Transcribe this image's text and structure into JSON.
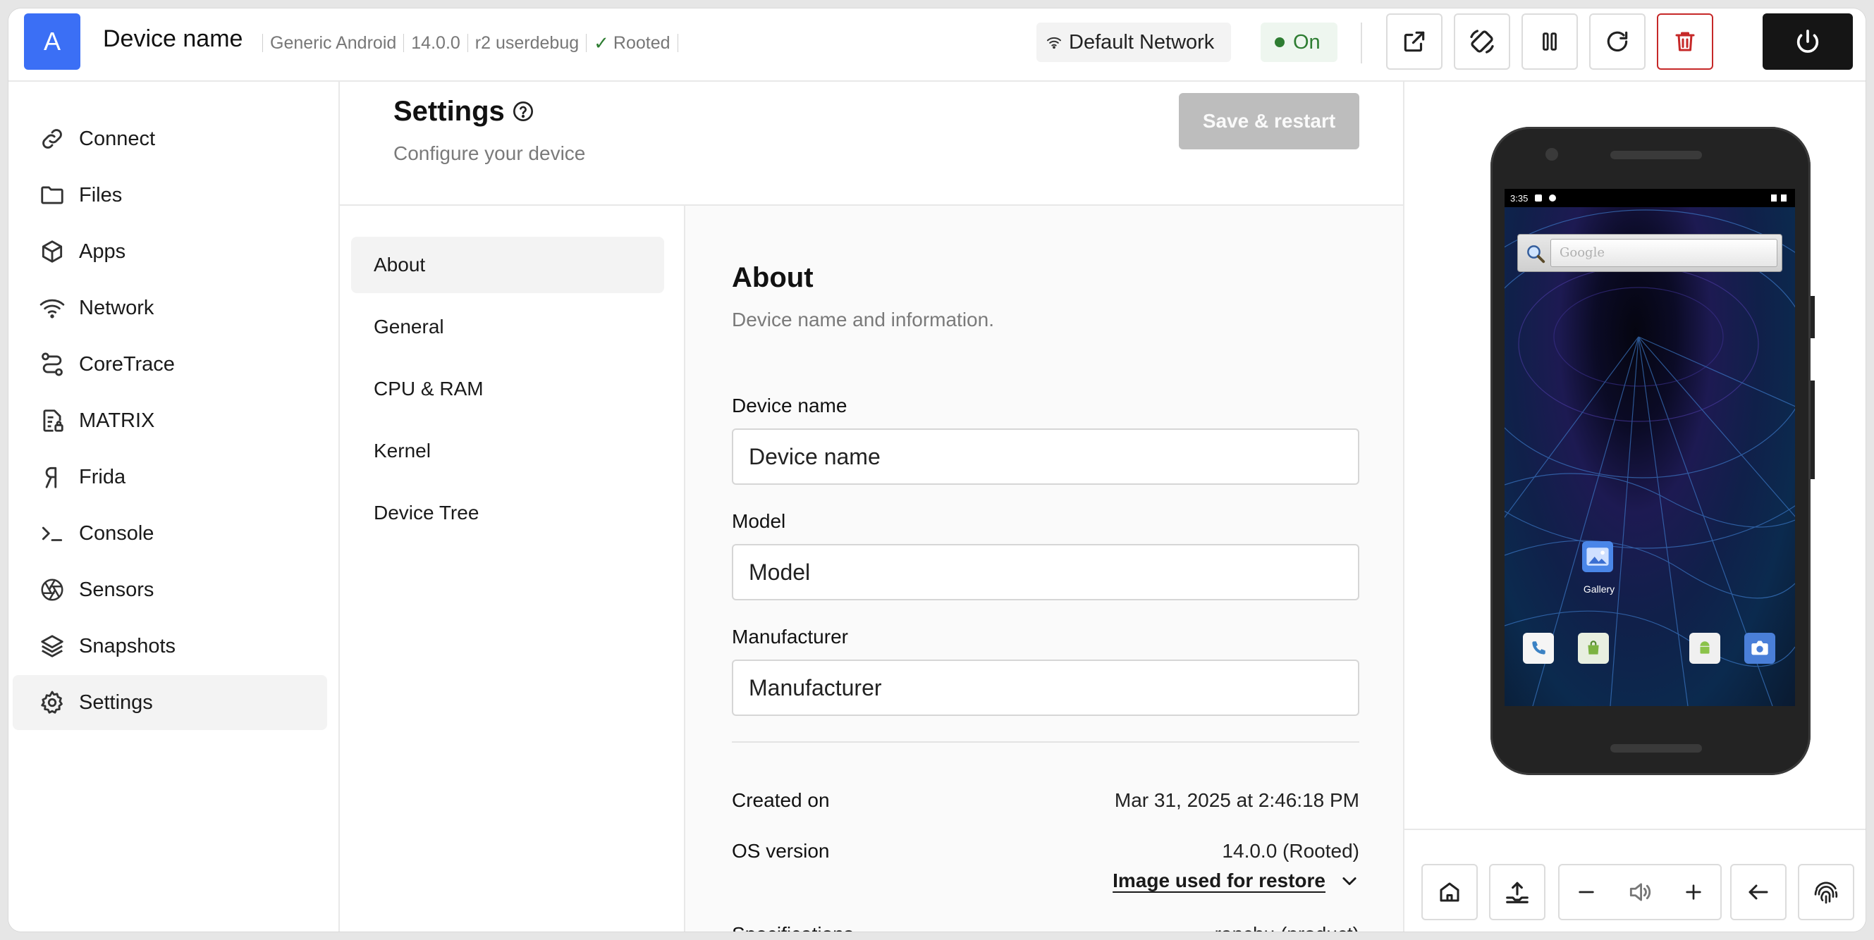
{
  "header": {
    "avatar_letter": "A",
    "device_name": "Device name",
    "meta": [
      "Generic Android",
      "14.0.0",
      "r2 userdebug",
      "Rooted"
    ],
    "network_label": "Default Network",
    "status_label": "On",
    "toolbar_icons": [
      "external-link-icon",
      "rotate-icon",
      "pause-icon",
      "refresh-icon",
      "trash-icon",
      "power-icon"
    ],
    "colors": {
      "accent": "#3b6ff5",
      "status": "#2e7d32",
      "danger": "#c62828"
    }
  },
  "sidebar": {
    "items": [
      {
        "label": "Connect",
        "icon": "link-icon"
      },
      {
        "label": "Files",
        "icon": "folder-icon"
      },
      {
        "label": "Apps",
        "icon": "cube-icon"
      },
      {
        "label": "Network",
        "icon": "wifi-icon"
      },
      {
        "label": "CoreTrace",
        "icon": "route-icon"
      },
      {
        "label": "MATRIX",
        "icon": "file-lock-icon"
      },
      {
        "label": "Frida",
        "icon": "frida-icon"
      },
      {
        "label": "Console",
        "icon": "terminal-icon"
      },
      {
        "label": "Sensors",
        "icon": "aperture-icon"
      },
      {
        "label": "Snapshots",
        "icon": "layers-icon"
      },
      {
        "label": "Settings",
        "icon": "gear-icon"
      }
    ],
    "active": "Settings"
  },
  "settings": {
    "title": "Settings",
    "subtitle": "Configure your device",
    "save_label": "Save & restart",
    "subnav": [
      "About",
      "General",
      "CPU & RAM",
      "Kernel",
      "Device Tree"
    ],
    "active_subnav": "About"
  },
  "about": {
    "title": "About",
    "subtitle": "Device name and information.",
    "fields": [
      {
        "label": "Device name",
        "placeholder": "Device name"
      },
      {
        "label": "Model",
        "placeholder": "Model"
      },
      {
        "label": "Manufacturer",
        "placeholder": "Manufacturer"
      }
    ],
    "created_label": "Created on",
    "created_value": "Mar 31, 2025 at 2:46:18 PM",
    "os_label": "OS version",
    "os_value": "14.0.0 (Rooted)",
    "restore_link": "Image used for restore",
    "specs_label": "Specifications",
    "specs_value": "ranchu (product)"
  },
  "device_screen": {
    "clock": "3:35",
    "search_placeholder": "Google",
    "gallery_label": "Gallery"
  },
  "device_controls": [
    "home-icon",
    "upload-icon",
    "volume-down-icon",
    "volume-icon",
    "volume-up-icon",
    "back-icon",
    "fingerprint-icon"
  ]
}
